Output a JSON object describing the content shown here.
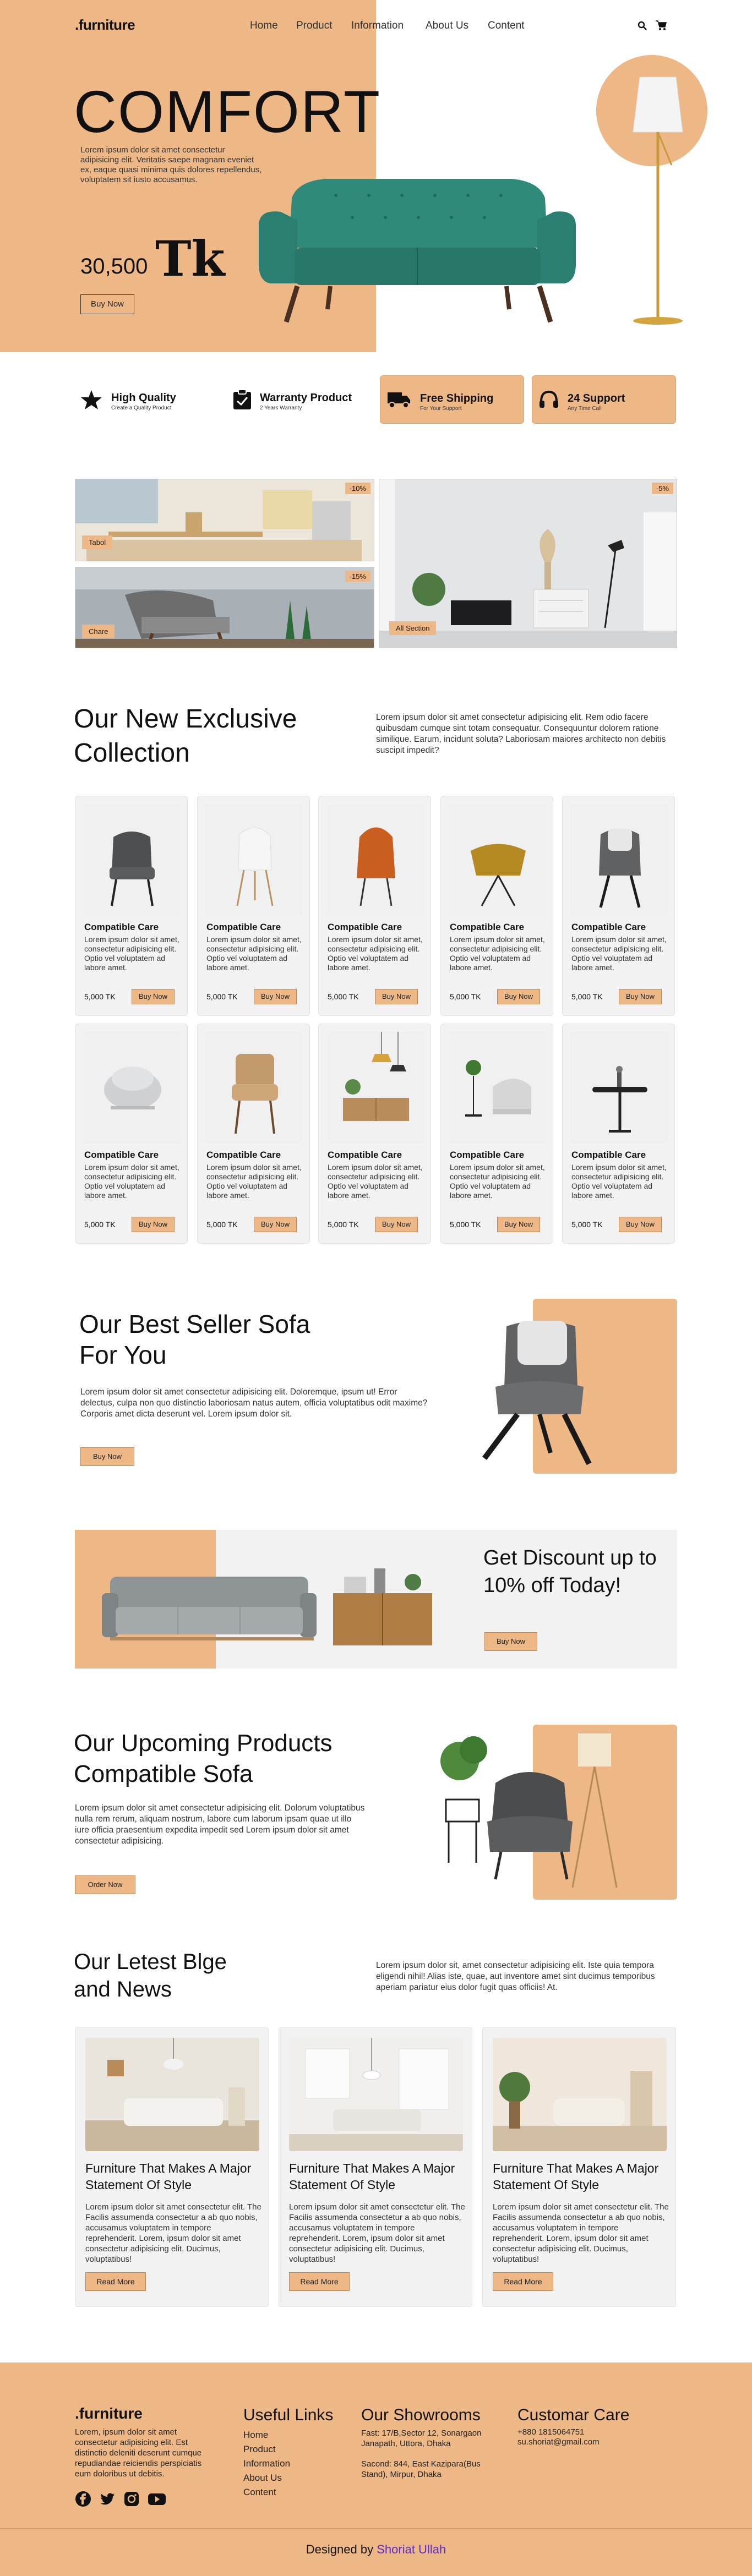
{
  "header": {
    "logo": ".furniture",
    "nav": [
      "Home",
      "Product",
      "Information",
      "About Us",
      "Content"
    ]
  },
  "hero": {
    "title": "COMFORT",
    "desc": "Lorem ipsum dolor sit amet consectetur adipisicing elit. Veritatis saepe magnam eveniet ex, eaque quasi minima quis dolores repellendus, voluptatem sit iusto accusamus.",
    "price": "30,500",
    "currency": "Tk",
    "button": "Buy Now"
  },
  "features": [
    {
      "title": "High Quality",
      "sub": "Create a Quality Product"
    },
    {
      "title": "Warranty Product",
      "sub": "2 Years Warranty"
    },
    {
      "title": "Free Shipping",
      "sub": "For Your Support"
    },
    {
      "title": "24 Support",
      "sub": "Any Time Call"
    }
  ],
  "gallery": [
    {
      "label": "Tabol",
      "discount": "-10%"
    },
    {
      "label": "Chare",
      "discount": "-15%"
    },
    {
      "label": "All Section",
      "discount": "-5%"
    }
  ],
  "collection": {
    "title": "Our New Exclusive Collection",
    "desc": "Lorem ipsum dolor sit amet consectetur adipisicing elit. Rem odio facere quibusdam cumque sint totam consequatur. Consequuntur dolorem ratione similique. Earum, incidunt soluta? Laboriosam maiores architecto non debitis suscipit impedit?",
    "product": {
      "title": "Compatible Care",
      "desc": "Lorem ipsum dolor sit amet, consectetur adipisicing elit. Optio vel voluptatem ad labore amet.",
      "price": "5,000 TK",
      "button": "Buy Now"
    }
  },
  "bestseller": {
    "title": "Our Best Seller Sofa For You",
    "desc": "Lorem ipsum dolor sit amet consectetur adipisicing elit. Doloremque, ipsum ut! Error delectus, culpa non quo distinctio laboriosam natus autem, officia voluptatibus odit maxime? Corporis amet dicta deserunt vel. Lorem ipsum dolor sit.",
    "button": "Buy Now"
  },
  "discount": {
    "title": "Get Discount up to 10% off Today!",
    "button": "Buy Now"
  },
  "upcoming": {
    "title": "Our Upcoming Products Compatible Sofa",
    "desc": "Lorem ipsum dolor sit amet consectetur adipisicing elit. Dolorum voluptatibus nulla rem rerum, aliquam nostrum, labore cum laborum ipsam quae ut illo iure officia praesentium expedita impedit sed Lorem ipsum dolor sit amet consectetur adipisicing.",
    "button": "Order Now"
  },
  "blog": {
    "title": "Our Letest Blge and News",
    "desc": "Lorem ipsum dolor sit, amet consectetur adipisicing elit. Iste quia tempora eligendi nihil! Alias iste, quae, aut inventore amet sint ducimus temporibus aperiam pariatur eius dolor fugit quas officiis! At.",
    "post": {
      "title": "Furniture That Makes A Major Statement Of Style",
      "desc": "Lorem ipsum dolor sit amet consectetur elit. The Facilis assumenda consectetur a ab quo nobis, accusamus voluptatem in tempore reprehenderit. Lorem, ipsum dolor sit amet consectetur adipisicing elit. Ducimus, voluptatibus!",
      "button": "Read More"
    }
  },
  "footer": {
    "brand": ".furniture",
    "brand_desc": "Lorem, ipsum dolor sit amet consectetur adipisicing elit. Est distinctio deleniti deserunt cumque repudiandae reiciendis perspiciatis eum doloribus ut debitis.",
    "links_title": "Useful Links",
    "links": [
      "Home",
      "Product",
      "Information",
      "About Us",
      "Content"
    ],
    "showrooms_title": "Our Showrooms",
    "showroom1": "Fast: 17/B,Sector 12, Sonargaon Janapath, Uttora, Dhaka",
    "showroom2": "Sacond: 844, East Kazipara(Bus Stand), Mirpur, Dhaka",
    "care_title": "Customar Care",
    "phone": "+880 1815064751",
    "email": "su.shoriat@gmail.com",
    "credit": "Designed by",
    "author": "Shoriat Ullah"
  },
  "colors": {
    "accent": "#EDB786",
    "author": "#5b2bd6"
  }
}
